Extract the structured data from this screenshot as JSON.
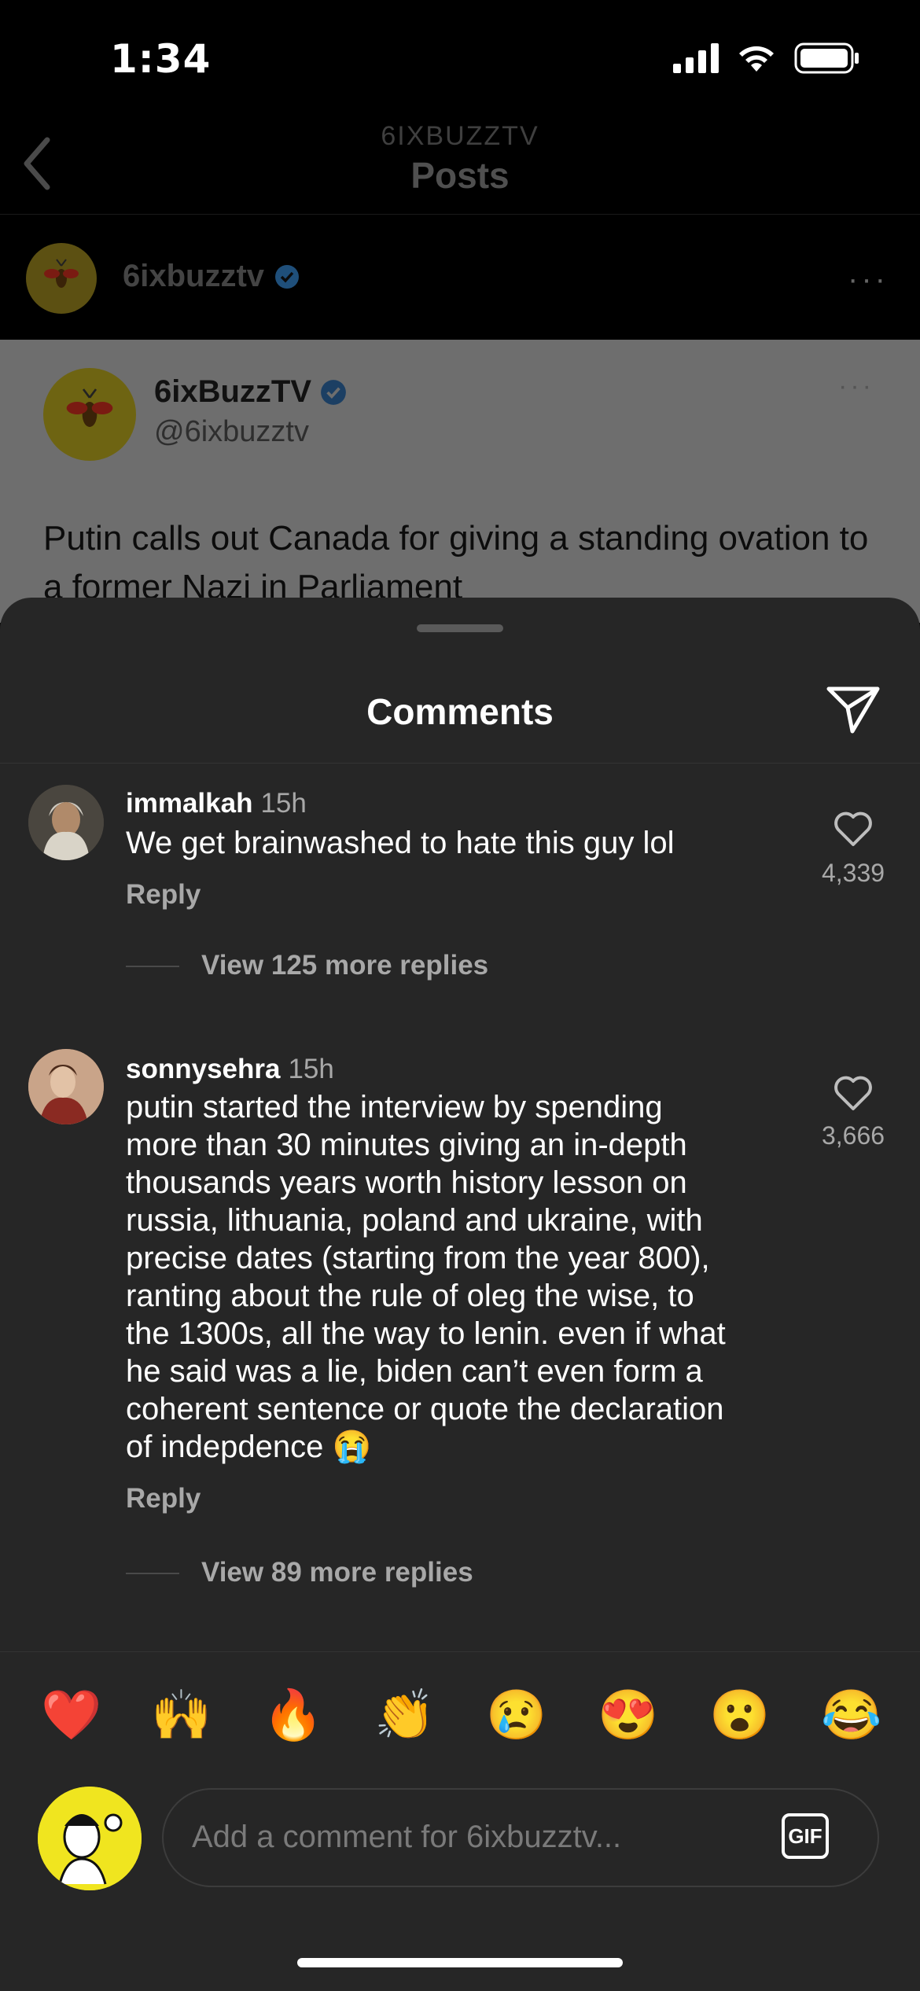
{
  "status_bar": {
    "time": "1:34"
  },
  "nav": {
    "subtitle": "6IXBUZZTV",
    "title": "Posts"
  },
  "post_header": {
    "username": "6ixbuzztv",
    "more": "···"
  },
  "tweet": {
    "name": "6ixBuzzTV",
    "handle": "@6ixbuzztv",
    "more": "···",
    "text": "Putin calls out Canada for giving a standing ovation to a former Nazi in Parliament"
  },
  "comments_sheet": {
    "title": "Comments",
    "comments": [
      {
        "user": "immalkah",
        "time": "15h",
        "text": "We get brainwashed to hate this guy lol",
        "reply_label": "Reply",
        "view_replies": "View 125 more replies",
        "likes": "4,339"
      },
      {
        "user": "sonnysehra",
        "time": "15h",
        "text": "putin started the interview by spending\nmore than 30 minutes giving an in-depth\nthousands years worth history lesson on\nrussia, lithuania, poland and ukraine, with\nprecise dates (starting from the year 800),\nranting about the rule of oleg the wise, to\nthe 1300s, all the way to lenin. even if what\nhe said was a lie, biden can’t even form a\ncoherent sentence or quote the declaration\nof indepdence 😭",
        "reply_label": "Reply",
        "view_replies": "View 89 more replies",
        "likes": "3,666"
      }
    ]
  },
  "quick_reactions": [
    "❤️",
    "🙌",
    "🔥",
    "👏",
    "😢",
    "😍",
    "😮",
    "😂"
  ],
  "composer": {
    "placeholder": "Add a comment for 6ixbuzztv...",
    "gif_label": "GIF"
  },
  "colors": {
    "verified": "#0095f6",
    "sheet": "#262626",
    "muted": "#a8a8a8"
  }
}
